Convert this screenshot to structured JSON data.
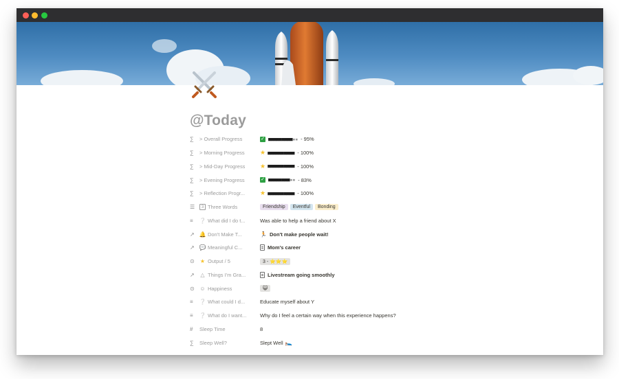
{
  "page": {
    "title": "@Today"
  },
  "colors": {
    "title_gray": "#9b9b9b",
    "tag_purple": "#e8deee",
    "tag_blue": "#d3e5ef",
    "tag_yellow": "#fbeecc",
    "check_green": "#2ea043",
    "star_yellow": "#f6c22d"
  },
  "properties": {
    "overall_progress": {
      "label": "> Overall Progress",
      "icon": "sigma-icon",
      "status_icon": "checkbox-icon",
      "progress": 0.95,
      "text": "- 95%"
    },
    "morning_progress": {
      "label": "> Morning Progress",
      "icon": "sigma-icon",
      "status_icon": "star-icon",
      "progress": 1.0,
      "text": "- 100%"
    },
    "midday_progress": {
      "label": "> Mid-Day Progress",
      "icon": "sigma-icon",
      "status_icon": "star-icon",
      "progress": 1.0,
      "text": "- 100%"
    },
    "evening_progress": {
      "label": "> Evening Progress",
      "icon": "sigma-icon",
      "status_icon": "checkbox-icon",
      "progress": 0.83,
      "text": "- 83%"
    },
    "reflection_progress": {
      "label": "> Reflection Progr...",
      "icon": "sigma-icon",
      "status_icon": "star-icon",
      "progress": 1.0,
      "text": "- 100%"
    },
    "three_words": {
      "label": "Three Words",
      "icon": "list-icon",
      "emoji": "number-3-icon",
      "tags": [
        "Friendship",
        "Eventful",
        "Bonding"
      ]
    },
    "what_did_i_do": {
      "label": "What did I do t...",
      "icon": "text-icon",
      "emoji": "question-icon",
      "value": "Was able to help a friend about X"
    },
    "dont_make": {
      "label": "Don't Make T...",
      "icon": "relation-icon",
      "emoji": "bell-icon",
      "value": "Don't make people wait!"
    },
    "meaningful": {
      "label": "Meaningful C...",
      "icon": "relation-icon",
      "emoji": "speech-bubble-icon",
      "value": "Mom's career"
    },
    "output": {
      "label": "Output / 5",
      "icon": "select-icon",
      "emoji": "star-icon",
      "value": "3 - ⭐⭐⭐"
    },
    "things_grateful": {
      "label": "Things I'm Gra...",
      "icon": "relation-icon",
      "emoji": "triangle-icon",
      "value": "Livestream going smoothly"
    },
    "happiness": {
      "label": "Happiness",
      "icon": "select-icon",
      "emoji": "smile-icon",
      "value": "😺"
    },
    "what_could_i_do": {
      "label": "What could I d...",
      "icon": "text-icon",
      "emoji": "question-icon",
      "value": "Educate myself about Y"
    },
    "what_do_i_want": {
      "label": "What do I want...",
      "icon": "text-icon",
      "emoji": "question-icon",
      "value": "Why do I feel a certain way when this experience happens?"
    },
    "sleep_time": {
      "label": "Sleep Time",
      "icon": "hash-icon",
      "value": "8"
    },
    "sleep_well": {
      "label": "Sleep Well?",
      "icon": "sigma-icon",
      "value": "Slept Well",
      "value_icon": "sleeping-icon"
    }
  }
}
